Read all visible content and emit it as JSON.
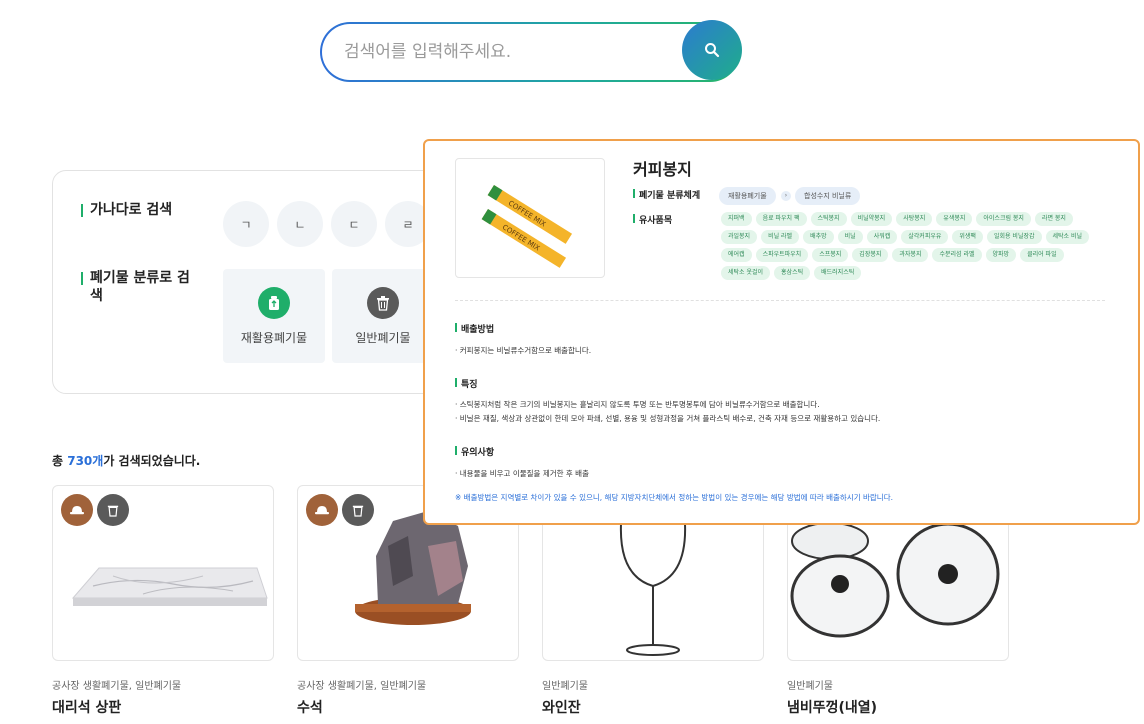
{
  "search": {
    "placeholder": "검색어를 입력해주세요."
  },
  "filters": {
    "alpha_label": "가나다로 검색",
    "consonants": [
      "ㄱ",
      "ㄴ",
      "ㄷ",
      "ㄹ"
    ],
    "category_label": "폐기물 분류로 검색",
    "categories": [
      {
        "label": "재활용폐기물",
        "icon": "recycle-icon",
        "color": "#1fae6a"
      },
      {
        "label": "일반폐기물",
        "icon": "trash-icon",
        "color": "#5a5a5a"
      }
    ]
  },
  "results": {
    "prefix": "총 ",
    "count": "730개",
    "suffix": "가 검색되었습니다."
  },
  "products": [
    {
      "category": "공사장 생활폐기물, 일반폐기물",
      "name": "대리석 상판"
    },
    {
      "category": "공사장 생활폐기물, 일반폐기물",
      "name": "수석"
    },
    {
      "category": "일반폐기물",
      "name": "와인잔"
    },
    {
      "category": "일반폐기물",
      "name": "냄비뚜껑(내열)"
    }
  ],
  "popup": {
    "title": "커피봉지",
    "image_text": "COFFEE MIX",
    "classification_label": "폐기물 분류체계",
    "classification": [
      "재활용폐기물",
      "합성수지 비닐류"
    ],
    "similar_label": "유사품목",
    "similar": [
      "지퍼백",
      "음료 파우치 팩",
      "스틱봉지",
      "비닐약봉지",
      "사탕봉지",
      "유색봉지",
      "아이스크림 봉지",
      "라면 봉지",
      "과일봉지",
      "비닐 라벨",
      "배추망",
      "비닐",
      "사워캡",
      "살각커피우유",
      "위생팩",
      "일회용 비닐장갑",
      "세탁소 비닐",
      "에어캡",
      "스파우트파우치",
      "스프봉지",
      "김장봉지",
      "과자봉지",
      "수분리섬 라벨",
      "양파망",
      "클리어 파일",
      "세탁소 옷걸이",
      "홍삼스틱",
      "배드러지스틱"
    ],
    "disposal_label": "배출방법",
    "disposal": "· 커피봉지는 비닐류수거함으로 배출합니다.",
    "features_label": "특징",
    "features": [
      "· 스틱봉지처럼 작은 크기의 비닐봉지는 흩날리지 않도록 투명 또는 반투명봉투에 담아 비닐류수거함으로 배출합니다.",
      "· 비닐은 재질, 색상과 상관없이 한데 모아 파쇄, 선별, 용융 및 성형과정을 거쳐 플라스틱 배수로, 건축 자재 등으로 재활용하고 있습니다."
    ],
    "caution_label": "유의사항",
    "caution": "· 내용물을 비우고 이물질을 제거한 후 배출",
    "notice": "※ 배출방법은 지역별로 차이가 있을 수 있으니, 해당 지방자치단체에서 정하는 방법이 있는 경우에는 해당 방법에 따라 배출하시기 바랍니다."
  }
}
